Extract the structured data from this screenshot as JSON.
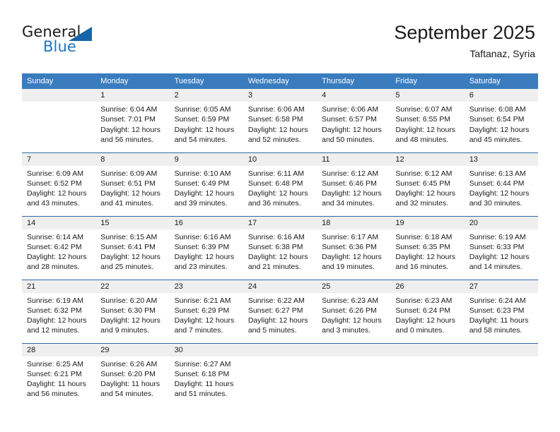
{
  "brand": {
    "name_part1": "General",
    "name_part2": "Blue",
    "triangle_color": "#1565a8",
    "blue_color": "#1b74c4"
  },
  "header": {
    "title": "September 2025",
    "subtitle": "Taftanaz, Syria"
  },
  "colors": {
    "header_bg": "#3a7cbe",
    "daynum_bg": "#efefef",
    "row_divider": "#2c6aa8",
    "text": "#1b1b1b"
  },
  "weekday_headers": [
    "Sunday",
    "Monday",
    "Tuesday",
    "Wednesday",
    "Thursday",
    "Friday",
    "Saturday"
  ],
  "weeks": [
    [
      {
        "day": "",
        "lines": []
      },
      {
        "day": "1",
        "lines": [
          "Sunrise: 6:04 AM",
          "Sunset: 7:01 PM",
          "Daylight: 12 hours",
          "and 56 minutes."
        ]
      },
      {
        "day": "2",
        "lines": [
          "Sunrise: 6:05 AM",
          "Sunset: 6:59 PM",
          "Daylight: 12 hours",
          "and 54 minutes."
        ]
      },
      {
        "day": "3",
        "lines": [
          "Sunrise: 6:06 AM",
          "Sunset: 6:58 PM",
          "Daylight: 12 hours",
          "and 52 minutes."
        ]
      },
      {
        "day": "4",
        "lines": [
          "Sunrise: 6:06 AM",
          "Sunset: 6:57 PM",
          "Daylight: 12 hours",
          "and 50 minutes."
        ]
      },
      {
        "day": "5",
        "lines": [
          "Sunrise: 6:07 AM",
          "Sunset: 6:55 PM",
          "Daylight: 12 hours",
          "and 48 minutes."
        ]
      },
      {
        "day": "6",
        "lines": [
          "Sunrise: 6:08 AM",
          "Sunset: 6:54 PM",
          "Daylight: 12 hours",
          "and 45 minutes."
        ]
      }
    ],
    [
      {
        "day": "7",
        "lines": [
          "Sunrise: 6:09 AM",
          "Sunset: 6:52 PM",
          "Daylight: 12 hours",
          "and 43 minutes."
        ]
      },
      {
        "day": "8",
        "lines": [
          "Sunrise: 6:09 AM",
          "Sunset: 6:51 PM",
          "Daylight: 12 hours",
          "and 41 minutes."
        ]
      },
      {
        "day": "9",
        "lines": [
          "Sunrise: 6:10 AM",
          "Sunset: 6:49 PM",
          "Daylight: 12 hours",
          "and 39 minutes."
        ]
      },
      {
        "day": "10",
        "lines": [
          "Sunrise: 6:11 AM",
          "Sunset: 6:48 PM",
          "Daylight: 12 hours",
          "and 36 minutes."
        ]
      },
      {
        "day": "11",
        "lines": [
          "Sunrise: 6:12 AM",
          "Sunset: 6:46 PM",
          "Daylight: 12 hours",
          "and 34 minutes."
        ]
      },
      {
        "day": "12",
        "lines": [
          "Sunrise: 6:12 AM",
          "Sunset: 6:45 PM",
          "Daylight: 12 hours",
          "and 32 minutes."
        ]
      },
      {
        "day": "13",
        "lines": [
          "Sunrise: 6:13 AM",
          "Sunset: 6:44 PM",
          "Daylight: 12 hours",
          "and 30 minutes."
        ]
      }
    ],
    [
      {
        "day": "14",
        "lines": [
          "Sunrise: 6:14 AM",
          "Sunset: 6:42 PM",
          "Daylight: 12 hours",
          "and 28 minutes."
        ]
      },
      {
        "day": "15",
        "lines": [
          "Sunrise: 6:15 AM",
          "Sunset: 6:41 PM",
          "Daylight: 12 hours",
          "and 25 minutes."
        ]
      },
      {
        "day": "16",
        "lines": [
          "Sunrise: 6:16 AM",
          "Sunset: 6:39 PM",
          "Daylight: 12 hours",
          "and 23 minutes."
        ]
      },
      {
        "day": "17",
        "lines": [
          "Sunrise: 6:16 AM",
          "Sunset: 6:38 PM",
          "Daylight: 12 hours",
          "and 21 minutes."
        ]
      },
      {
        "day": "18",
        "lines": [
          "Sunrise: 6:17 AM",
          "Sunset: 6:36 PM",
          "Daylight: 12 hours",
          "and 19 minutes."
        ]
      },
      {
        "day": "19",
        "lines": [
          "Sunrise: 6:18 AM",
          "Sunset: 6:35 PM",
          "Daylight: 12 hours",
          "and 16 minutes."
        ]
      },
      {
        "day": "20",
        "lines": [
          "Sunrise: 6:19 AM",
          "Sunset: 6:33 PM",
          "Daylight: 12 hours",
          "and 14 minutes."
        ]
      }
    ],
    [
      {
        "day": "21",
        "lines": [
          "Sunrise: 6:19 AM",
          "Sunset: 6:32 PM",
          "Daylight: 12 hours",
          "and 12 minutes."
        ]
      },
      {
        "day": "22",
        "lines": [
          "Sunrise: 6:20 AM",
          "Sunset: 6:30 PM",
          "Daylight: 12 hours",
          "and 9 minutes."
        ]
      },
      {
        "day": "23",
        "lines": [
          "Sunrise: 6:21 AM",
          "Sunset: 6:29 PM",
          "Daylight: 12 hours",
          "and 7 minutes."
        ]
      },
      {
        "day": "24",
        "lines": [
          "Sunrise: 6:22 AM",
          "Sunset: 6:27 PM",
          "Daylight: 12 hours",
          "and 5 minutes."
        ]
      },
      {
        "day": "25",
        "lines": [
          "Sunrise: 6:23 AM",
          "Sunset: 6:26 PM",
          "Daylight: 12 hours",
          "and 3 minutes."
        ]
      },
      {
        "day": "26",
        "lines": [
          "Sunrise: 6:23 AM",
          "Sunset: 6:24 PM",
          "Daylight: 12 hours",
          "and 0 minutes."
        ]
      },
      {
        "day": "27",
        "lines": [
          "Sunrise: 6:24 AM",
          "Sunset: 6:23 PM",
          "Daylight: 11 hours",
          "and 58 minutes."
        ]
      }
    ],
    [
      {
        "day": "28",
        "lines": [
          "Sunrise: 6:25 AM",
          "Sunset: 6:21 PM",
          "Daylight: 11 hours",
          "and 56 minutes."
        ]
      },
      {
        "day": "29",
        "lines": [
          "Sunrise: 6:26 AM",
          "Sunset: 6:20 PM",
          "Daylight: 11 hours",
          "and 54 minutes."
        ]
      },
      {
        "day": "30",
        "lines": [
          "Sunrise: 6:27 AM",
          "Sunset: 6:18 PM",
          "Daylight: 11 hours",
          "and 51 minutes."
        ]
      },
      {
        "day": "",
        "lines": []
      },
      {
        "day": "",
        "lines": []
      },
      {
        "day": "",
        "lines": []
      },
      {
        "day": "",
        "lines": []
      }
    ]
  ]
}
